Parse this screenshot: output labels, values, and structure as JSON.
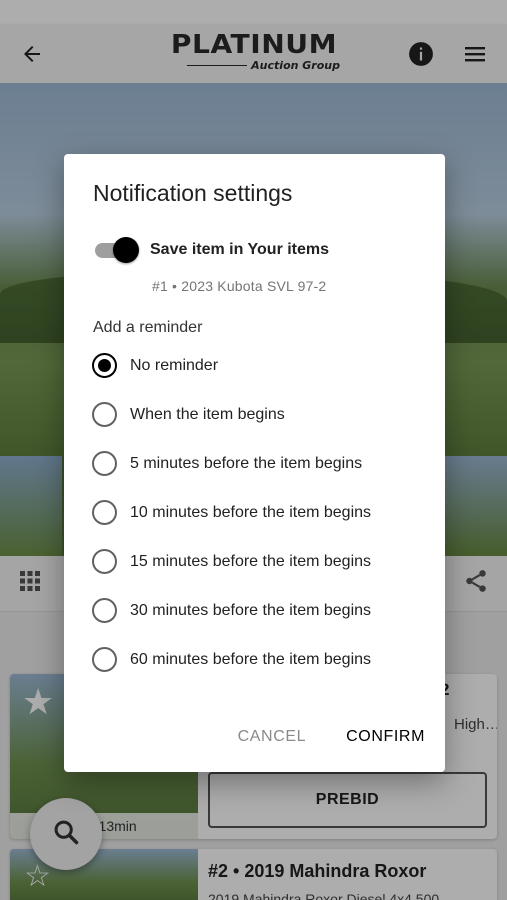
{
  "app": {
    "logo_main": "PLATINUM",
    "logo_sub": "Auction Group"
  },
  "icons": {
    "back": "arrow-left-icon",
    "info": "info-icon",
    "menu": "hamburger-menu-icon",
    "grid": "grid-icon",
    "share": "share-icon",
    "search": "search-icon",
    "star": "star-icon"
  },
  "background": {
    "card1": {
      "title_fragment": "2",
      "desc_fragment": "High…",
      "time_left": "22h 13min",
      "prebid_label": "PREBID"
    },
    "card2": {
      "title": "#2 • 2019 Mahindra Roxor",
      "desc": "2019 Mahindra Roxor Diesel 4x4 500"
    }
  },
  "dialog": {
    "title": "Notification settings",
    "save_toggle": {
      "label": "Save item in Your items",
      "on": true
    },
    "item_ref": "#1 • 2023 Kubota SVL 97-2",
    "reminder_label": "Add a reminder",
    "options": [
      {
        "label": "No reminder",
        "selected": true
      },
      {
        "label": "When the item begins",
        "selected": false
      },
      {
        "label": "5 minutes before the item begins",
        "selected": false
      },
      {
        "label": "10 minutes before the item begins",
        "selected": false
      },
      {
        "label": "15 minutes before the item begins",
        "selected": false
      },
      {
        "label": "30 minutes before the item begins",
        "selected": false
      },
      {
        "label": "60 minutes before the item begins",
        "selected": false
      }
    ],
    "cancel_label": "CANCEL",
    "confirm_label": "CONFIRM"
  },
  "colors": {
    "appbar": "#f5f5f5",
    "accent": "#000000",
    "scrim": "rgba(0,0,0,0.32)"
  }
}
